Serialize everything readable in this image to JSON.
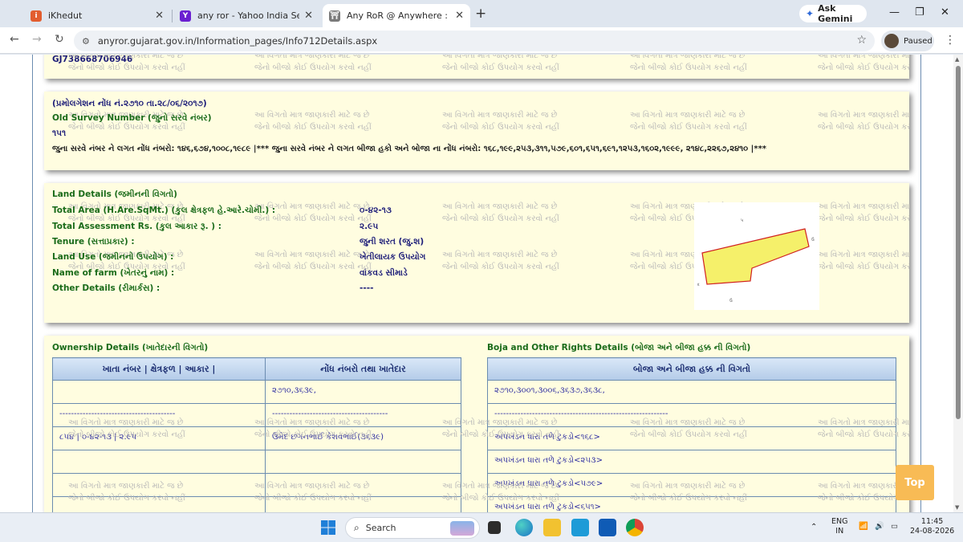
{
  "browser": {
    "tabs": [
      {
        "title": "iKhedut",
        "favicon_color": "#e25d2f"
      },
      {
        "title": "any ror - Yahoo India Search Ro",
        "favicon_color": "#6a1fd1"
      },
      {
        "title": "Any RoR @ Anywhere :",
        "favicon_color": "#7a7a7a"
      }
    ],
    "new_tab": "+",
    "gemini_label": "Ask Gemini",
    "url": "anyror.gujarat.gov.in/Information_pages/Info712Details.aspx",
    "profile_label": "Paused",
    "window_controls": [
      "—",
      "❐",
      "✕"
    ]
  },
  "watermark": {
    "line1": "આ વિગતો માત્ર જાણકારી માટે જ છે",
    "line2": "જેનો બીજો કોઈ ઉપયોગ કરવો નહીં"
  },
  "header_panel": {
    "upin": "GJ738668706946"
  },
  "survey_panel": {
    "promulgation": "(પ્રમોલગેશન નોંધ નં.૨૭૧૦ તા.૨૮/૦૬/૨૦૧૭)",
    "old_survey_label": "Old Survey Number (જુનો સરવે નંબર)",
    "old_survey_value": "૧૫૧",
    "entries_note": "જુના સરવે નંબર ને લગત નોંધ નંબરો: ૧૪૬,૬૭૪,૧૦૦૮,૧૯૮૯ |*** જુના સરવે નંબર ને લગત બીજા હકો અને બોજા ના નોંધ નંબરો: ૧૬૮,૧૯૯,૨૫૩,૩૧૧,૫૭૯,૬૦૧,૬૫૧,૬૯૧,૧૨૫૩,૧૬૦૨,૧૯૯૯, ૨૧૪૮,૨૨૬૭,૨૪૧૦ |***"
  },
  "land_panel": {
    "heading": "Land Details (જમીનની વિગતો)",
    "rows": [
      {
        "label": "Total Area (H.Are.SqMt.) (કુલ ક્ષેત્રફળ હે.આરે.ચોમી.) :",
        "value": "૦-૪૨-૧૩"
      },
      {
        "label": "Total Assessment Rs. (કુલ આકાર રૂ. ) :",
        "value": "૨.૯૫"
      },
      {
        "label": "Tenure (સત્તાપ્રકાર) :",
        "value": "જુની શરત (જુ.શ)"
      },
      {
        "label": "Land Use (જમીનનો ઉપયોગ) :",
        "value": "ખેતીલાયક ઉપયોગ"
      },
      {
        "label": "Name of farm (ખેતરનું નામ) :",
        "value": "વાંકવડ સીમાડે"
      },
      {
        "label": "Other Details (રીમાર્કસ) :",
        "value": "----"
      }
    ]
  },
  "ownership_panel": {
    "heading": "Ownership Details (ખાતેદારની વિગતો)",
    "columns": [
      "ખાતા નંબર | ક્ષેત્રફળ | આકાર |",
      "નોંધ નંબરો તથા ખાતેદાર"
    ],
    "rows": [
      [
        "",
        "૨૭૧૦,૩૬૩૯,"
      ],
      [
        "----------------------------------------",
        "----------------------------------------"
      ],
      [
        "૮૫૪ | ૦-૪૨-૧૩ | ૨.૯૫",
        "ઉમેદ છગનભાઈ કેશવભાઈ(૩૬૩૯)"
      ],
      [
        "",
        ""
      ],
      [
        "",
        ""
      ],
      [
        "",
        ""
      ]
    ]
  },
  "boja_panel": {
    "heading": "Boja and Other Rights Details (બોજા અને બીજા હક્ક ની વિગતો)",
    "columns": [
      "બોજા અને બીજા હક્ક ની વિગતો"
    ],
    "rows": [
      "૨૭૧૦,૩૦૦૧,૩૦૦૬,૩૬૩૭,૩૬૩૮,",
      "------------------------------------------------------------",
      "અપખંડન ધારા તળે ટુકડો<૧૬૮>",
      "અપખંડન ધારા તળે ટુકડો<૨૫૩>",
      "અપખંડન ધારા તળે ટુકડો<૫૭૯>",
      "અપખંડન ધારા તળે ટુકડો<૬૫૧>"
    ]
  },
  "top_button": "Top",
  "taskbar": {
    "search_placeholder": "Search",
    "lang_top": "ENG",
    "lang_bottom": "IN",
    "time": "11:45",
    "date": "24-08-2026"
  }
}
